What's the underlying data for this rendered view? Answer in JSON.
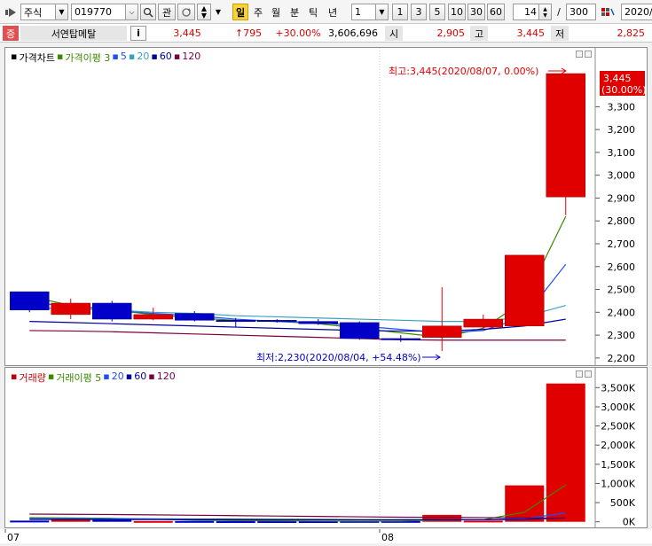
{
  "toolbar": {
    "menu_icon": "play-arrow-icon",
    "market_type": "주식",
    "stock_code": "019770",
    "search_icon": "magnifier-icon",
    "interest_label": "관",
    "period_tabs": [
      "일",
      "주",
      "월",
      "분",
      "틱",
      "년"
    ],
    "active_period": "일",
    "interval_value": "1",
    "interval_buttons": [
      "1",
      "3",
      "5",
      "10",
      "30",
      "60"
    ],
    "zoom_value": "14",
    "count_value": "300",
    "slash": "/",
    "date_value": "2020/"
  },
  "quote": {
    "badge": "증",
    "stock_name": "서연탑메탈",
    "info_button": "i",
    "price": "3,445",
    "change": "↑795",
    "change_rate": "+30.00%",
    "volume": "3,606,696",
    "open_label": "시",
    "open_value": "2,905",
    "high_label": "고",
    "high_value": "3,445",
    "low_label": "저",
    "low_value": "2,825"
  },
  "price_panel": {
    "legend": [
      {
        "text": "가격차트",
        "color": "#000000"
      },
      {
        "text": "가격이평 3",
        "color": "#3a8a00"
      },
      {
        "text": "5",
        "color": "#1a4fff"
      },
      {
        "text": "20",
        "color": "#3aa0c0"
      },
      {
        "text": "60",
        "color": "#00009a"
      },
      {
        "text": "120",
        "color": "#7a0040"
      }
    ],
    "high_annotation": "최고:3,445(2020/08/07, 0.00%)",
    "low_annotation": "최저:2,230(2020/08/04, +54.48%)",
    "current_price_label": "3,445",
    "current_rate_label": "(30.00%)"
  },
  "volume_panel": {
    "legend": [
      {
        "text": "거래량",
        "color": "#c00000"
      },
      {
        "text": "거래이평 5",
        "color": "#3a8a00"
      },
      {
        "text": "20",
        "color": "#1a4fff"
      },
      {
        "text": "60",
        "color": "#00009a"
      },
      {
        "text": "120",
        "color": "#7a0040"
      }
    ]
  },
  "colors": {
    "up": "#e00000",
    "down": "#0000c8",
    "ma3": "#3a8a00",
    "ma5": "#1a4fff",
    "ma20": "#3aa0c0",
    "ma60": "#00009a",
    "ma120": "#7a0040"
  },
  "chart_data": [
    {
      "type": "candlestick",
      "title": "가격차트",
      "x_labels": [
        "07",
        "08"
      ],
      "ylim": [
        2180,
        3480
      ],
      "yticks": [
        2200,
        2300,
        2400,
        2500,
        2600,
        2700,
        2800,
        2900,
        3000,
        3100,
        3200,
        3300
      ],
      "ytick_labels": [
        "2,200",
        "2,300",
        "2,400",
        "2,500",
        "2,600",
        "2,700",
        "2,800",
        "2,900",
        "3,000",
        "3,100",
        "3,200",
        "3,300"
      ],
      "candles": [
        {
          "open": 2490,
          "close": 2410,
          "high": 2490,
          "low": 2400
        },
        {
          "open": 2390,
          "close": 2440,
          "high": 2460,
          "low": 2370
        },
        {
          "open": 2440,
          "close": 2370,
          "high": 2450,
          "low": 2360
        },
        {
          "open": 2370,
          "close": 2390,
          "high": 2420,
          "low": 2365
        },
        {
          "open": 2395,
          "close": 2365,
          "high": 2405,
          "low": 2360
        },
        {
          "open": 2365,
          "close": 2360,
          "high": 2375,
          "low": 2335
        },
        {
          "open": 2365,
          "close": 2360,
          "high": 2370,
          "low": 2355
        },
        {
          "open": 2360,
          "close": 2350,
          "high": 2370,
          "low": 2345
        },
        {
          "open": 2355,
          "close": 2285,
          "high": 2360,
          "low": 2280
        },
        {
          "open": 2285,
          "close": 2280,
          "high": 2300,
          "low": 2270
        },
        {
          "open": 2290,
          "close": 2340,
          "high": 2510,
          "low": 2230
        },
        {
          "open": 2335,
          "close": 2370,
          "high": 2390,
          "low": 2330
        },
        {
          "open": 2340,
          "close": 2650,
          "high": 2650,
          "low": 2340
        },
        {
          "open": 2905,
          "close": 3445,
          "high": 3445,
          "low": 2825
        }
      ],
      "series": [
        {
          "name": "가격이평 3",
          "values": [
            2470,
            2430,
            2410,
            2390,
            2375,
            2365,
            2360,
            2350,
            2330,
            2310,
            2290,
            2330,
            2450,
            2820
          ]
        },
        {
          "name": "5",
          "values": [
            2440,
            2430,
            2410,
            2395,
            2385,
            2370,
            2360,
            2355,
            2340,
            2325,
            2310,
            2320,
            2380,
            2610
          ]
        },
        {
          "name": "20",
          "values": [
            2420,
            2415,
            2410,
            2400,
            2395,
            2385,
            2380,
            2375,
            2370,
            2365,
            2360,
            2360,
            2380,
            2430
          ]
        },
        {
          "name": "60",
          "values": [
            2360,
            2355,
            2350,
            2345,
            2340,
            2335,
            2330,
            2325,
            2320,
            2318,
            2318,
            2325,
            2340,
            2370
          ]
        },
        {
          "name": "120",
          "values": [
            2320,
            2318,
            2315,
            2310,
            2305,
            2300,
            2295,
            2290,
            2285,
            2280,
            2278,
            2278,
            2278,
            2278
          ]
        }
      ]
    },
    {
      "type": "bar",
      "title": "거래량",
      "x_labels": [
        "07",
        "08"
      ],
      "ylim": [
        -100,
        3600
      ],
      "yticks": [
        0,
        500,
        1000,
        1500,
        2000,
        2500,
        3000,
        3500
      ],
      "ytick_labels": [
        "0K",
        "500K",
        "1,000K",
        "1,500K",
        "2,000K",
        "2,500K",
        "3,000K",
        "3,500K"
      ],
      "values": [
        30,
        60,
        50,
        20,
        20,
        15,
        15,
        15,
        20,
        20,
        180,
        30,
        950,
        3607
      ],
      "bar_direction": [
        "down",
        "up",
        "down",
        "up",
        "down",
        "down",
        "down",
        "down",
        "down",
        "down",
        "up",
        "up",
        "up",
        "up"
      ],
      "series": [
        {
          "name": "거래이평 5",
          "values": [
            110,
            100,
            90,
            70,
            40,
            30,
            25,
            20,
            18,
            18,
            50,
            55,
            250,
            960
          ]
        },
        {
          "name": "20",
          "values": [
            80,
            80,
            78,
            76,
            72,
            70,
            66,
            62,
            58,
            56,
            58,
            56,
            80,
            230
          ]
        },
        {
          "name": "60",
          "values": [
            60,
            60,
            58,
            57,
            56,
            55,
            54,
            53,
            52,
            51,
            52,
            52,
            60,
            100
          ]
        },
        {
          "name": "120",
          "values": [
            200,
            195,
            190,
            180,
            170,
            160,
            150,
            140,
            130,
            120,
            115,
            110,
            100,
            100
          ]
        }
      ]
    }
  ]
}
